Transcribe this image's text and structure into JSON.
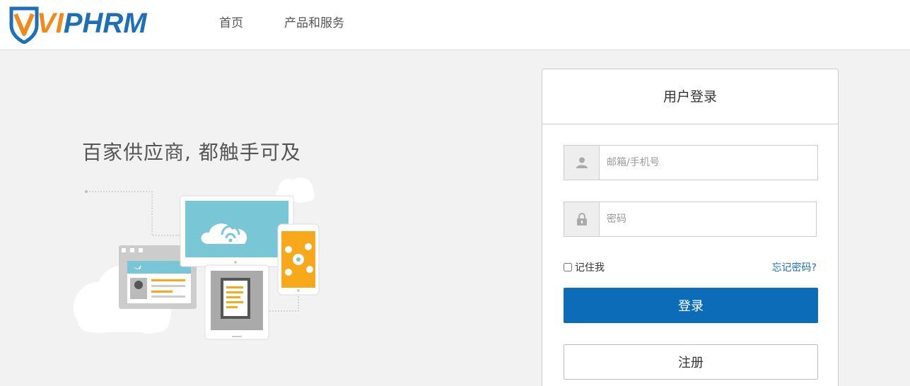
{
  "brand": {
    "logo_prefix": "V",
    "logo_highlight": "I",
    "logo_rest": "PHRM",
    "primary_color": "#1d6fb8",
    "accent_color": "#f08a1c"
  },
  "nav": {
    "items": [
      {
        "label": "首页"
      },
      {
        "label": "产品和服务"
      }
    ]
  },
  "hero": {
    "slogan": "百家供应商, 都触手可及"
  },
  "login": {
    "title": "用户登录",
    "email_placeholder": "邮箱/手机号",
    "email_value": "",
    "password_placeholder": "密码",
    "password_value": "",
    "remember_label": "记住我",
    "forgot_label": "忘记密码?",
    "login_button": "登录",
    "register_button": "注册",
    "login_button_color": "#0d6cb7"
  },
  "icons": {
    "user": "user-icon",
    "lock": "lock-icon"
  }
}
